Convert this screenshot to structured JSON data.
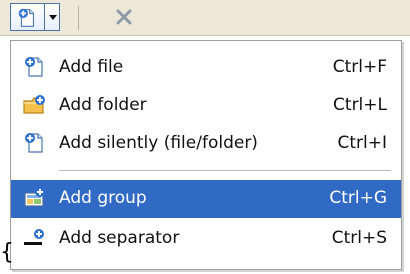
{
  "toolbar": {
    "add_icon": "add-file-icon",
    "dropdown_icon": "chevron-down-icon",
    "delete_icon": "close-icon"
  },
  "menu": {
    "items": [
      {
        "label": "Add file",
        "shortcut": "Ctrl+F",
        "icon": "file-add-icon",
        "selected": false
      },
      {
        "label": "Add folder",
        "shortcut": "Ctrl+L",
        "icon": "folder-add-icon",
        "selected": false
      },
      {
        "label": "Add silently (file/folder)",
        "shortcut": "Ctrl+I",
        "icon": "silent-add-icon",
        "selected": false
      },
      {
        "label": "Add group",
        "shortcut": "Ctrl+G",
        "icon": "group-add-icon",
        "selected": true
      },
      {
        "label": "Add separator",
        "shortcut": "Ctrl+S",
        "icon": "separator-add-icon",
        "selected": false
      }
    ]
  },
  "fragment": {
    "brace": "{"
  },
  "colors": {
    "selection": "#316ac5",
    "toolbar": "#ece9d8",
    "menu_border": "#9d9d9d"
  }
}
